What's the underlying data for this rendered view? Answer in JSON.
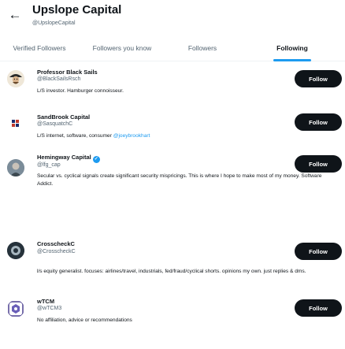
{
  "header": {
    "back_icon": "arrow-left-icon",
    "title": "Upslope Capital",
    "handle": "@UpslopeCapital"
  },
  "tabs": [
    {
      "label": "Verified Followers",
      "active": false
    },
    {
      "label": "Followers you know",
      "active": false
    },
    {
      "label": "Followers",
      "active": false
    },
    {
      "label": "Following",
      "active": true
    }
  ],
  "accent_color": "#1d9bf0",
  "follow_label": "Follow",
  "users": [
    {
      "name": "Professor Black Sails",
      "handle": "@BlackSailsRsch",
      "bio": "L/S investor. Hamburger connoisseur.",
      "verified": false,
      "avatar_icon": "sailor-avatar-icon"
    },
    {
      "name": "SandBrook Capital",
      "handle": "@SasquatchC",
      "bio": "L/S internet, software, consumer",
      "bio_mention": "@joeybrookhart",
      "verified": false,
      "avatar_icon": "sandbrook-logo-icon"
    },
    {
      "name": "Hemingway Capital",
      "handle": "@lfg_cap",
      "bio": "Secular vs. cyclical signals create significant security mispricings. This is where I hope to make most of my money. Software Addict.",
      "verified": true,
      "avatar_icon": "hemingway-avatar-icon"
    },
    {
      "name": "CrosscheckC",
      "handle": "@CrosscheckC",
      "bio": "l/s equity generalist. focuses: airlines/travel, industrials, fed/fraud/cyclical shorts. opinions my own. just replies & dms.",
      "verified": false,
      "avatar_icon": "crosscheck-avatar-icon"
    },
    {
      "name": "wTCM",
      "handle": "@wTCM3",
      "bio": "No affiliation, advice or recommendations",
      "verified": false,
      "avatar_icon": "wtcm-avatar-icon"
    }
  ]
}
